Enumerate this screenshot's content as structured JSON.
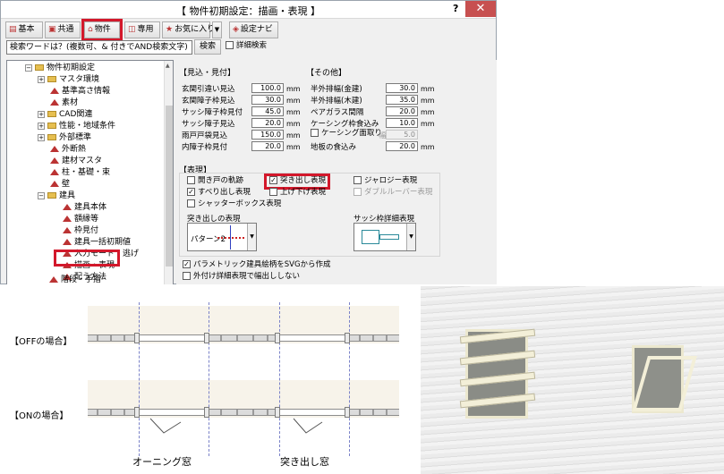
{
  "window": {
    "title": "【 物件初期設定：描画・表現 】",
    "help": "?",
    "close": "✕"
  },
  "toolbar": {
    "basic": "基本",
    "common": "共通",
    "property": "物件",
    "exclusive": "専用",
    "favorites": "お気に入り",
    "fav_dropdown": "▼",
    "navi": "設定ナビ"
  },
  "search": {
    "placeholder": "検索ワードは？(複数可、& 付きでAND検索文字)",
    "button": "検索",
    "detail": "詳細検索"
  },
  "tree": {
    "items": [
      {
        "label": "物件初期設定",
        "toggle": "−"
      },
      {
        "label": "マスタ環境",
        "toggle": "+"
      },
      {
        "label": "基準高さ情報"
      },
      {
        "label": "素材"
      },
      {
        "label": "CAD関連",
        "toggle": "+"
      },
      {
        "label": "性能・地域条件",
        "toggle": "+"
      },
      {
        "label": "外部標準",
        "toggle": "+"
      },
      {
        "label": "外断熱"
      },
      {
        "label": "建材マスタ"
      },
      {
        "label": "柱・基礎・束"
      },
      {
        "label": "壁"
      },
      {
        "label": "建具",
        "toggle": "−"
      },
      {
        "label": "建具本体"
      },
      {
        "label": "額縁等"
      },
      {
        "label": "枠見付"
      },
      {
        "label": "建具一括初期値"
      },
      {
        "label": "入力モード・逃げ"
      },
      {
        "label": "描画・表現"
      },
      {
        "label": "配う方法"
      },
      {
        "label": "階段・手摺"
      }
    ]
  },
  "mikomi": {
    "title": "【見込・見付】",
    "rows": [
      {
        "label": "玄関引違い見込",
        "value": "100.0",
        "unit": "mm"
      },
      {
        "label": "玄関障子枠見込",
        "value": "30.0",
        "unit": "mm"
      },
      {
        "label": "サッシ障子枠見付",
        "value": "45.0",
        "unit": "mm"
      },
      {
        "label": "サッシ障子見込",
        "value": "20.0",
        "unit": "mm"
      },
      {
        "label": "雨戸戸袋見込",
        "value": "150.0",
        "unit": "mm"
      },
      {
        "label": "内障子枠見付",
        "value": "20.0",
        "unit": "mm"
      }
    ]
  },
  "sonota": {
    "title": "【その他】",
    "rows": [
      {
        "label": "半外排幅(金建)",
        "value": "30.0",
        "unit": "mm"
      },
      {
        "label": "半外排幅(木建)",
        "value": "35.0",
        "unit": "mm"
      },
      {
        "label": "ペアガラス間隔",
        "value": "20.0",
        "unit": "mm"
      },
      {
        "label": "ケーシング枠食込み",
        "value": "10.0",
        "unit": "mm"
      },
      {
        "label": "ケーシング面取り",
        "sub": "幅",
        "value": "5.0"
      },
      {
        "label": "地板の食込み",
        "value": "20.0",
        "unit": "mm"
      }
    ]
  },
  "hyogen": {
    "title": "【表現】",
    "checks": {
      "open_door": "開き戸の軌跡",
      "slide_out": "すべり出し表現",
      "shutter_box": "シャッターボックス表現",
      "protrude": "突き出し表現",
      "up_down": "上げ下げ表現",
      "jalousie": "ジャロジー表現",
      "double_louver": "ダブルルーバー表現"
    },
    "protrude_label": "突き出しの表現",
    "pattern": "パターン2",
    "sash_label": "サッシ枠詳細表現",
    "dropdown": "▼"
  },
  "bottom_checks": {
    "parametric": "パラメトリック建具絵柄をSVGから作成",
    "outer": "外付け詳細表現で幅出ししない"
  },
  "lower": {
    "off_label": "【OFFの場合】",
    "on_label": "【ONの場合】",
    "awning": "オーニング窓",
    "projected": "突き出し窓"
  },
  "colors": {
    "highlight": "#d3182b",
    "accent": "#b33333"
  }
}
